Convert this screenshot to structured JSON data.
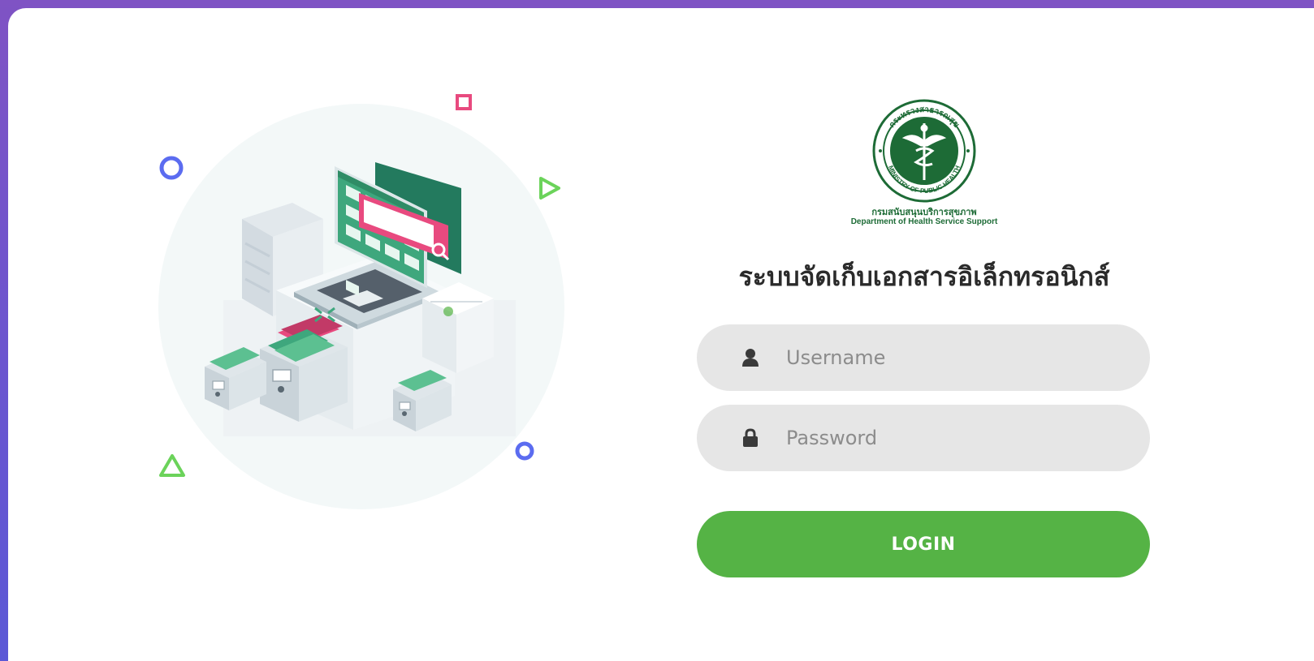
{
  "branding": {
    "logo_ring_top_text": "กระทรวงสาธารณสุข",
    "logo_ring_bottom_text": "MINISTRY OF PUBLIC HEALTH",
    "dept_thai": "กรมสนับสนุนบริการสุขภาพ",
    "dept_english": "Department of Health Service Support"
  },
  "login": {
    "title": "ระบบจัดเก็บเอกสารอิเล็กทรอนิกส์",
    "username_placeholder": "Username",
    "password_placeholder": "Password",
    "login_button": "LOGIN"
  },
  "icons": {
    "username": "user-icon",
    "password": "lock-icon"
  },
  "colors": {
    "accent_green": "#55b345",
    "logo_green": "#1d6b36",
    "input_bg": "#e6e6e6",
    "deco_pink": "#e84a7f",
    "deco_blue": "#5b6cf0",
    "deco_green": "#6bd35a"
  }
}
